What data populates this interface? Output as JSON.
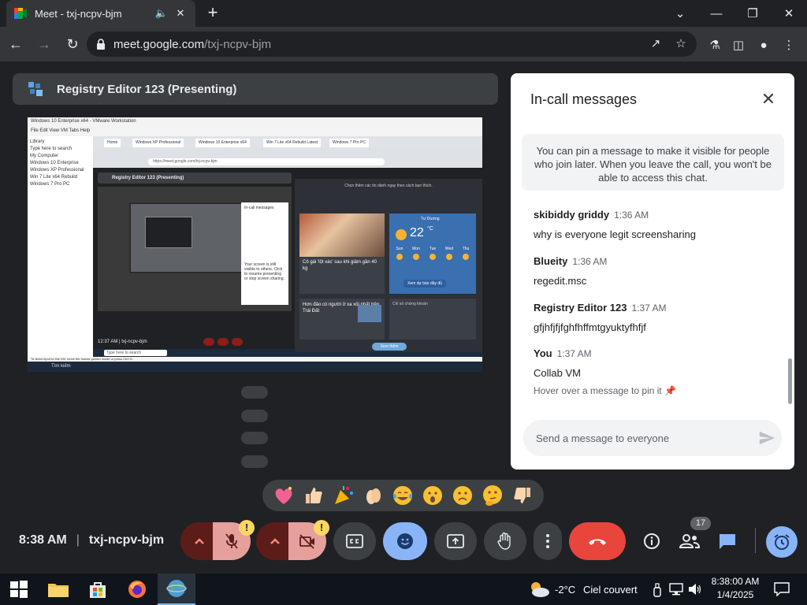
{
  "browser": {
    "tab_title": "Meet - txj-ncpv-bjm",
    "url_host": "meet.google.com",
    "url_path": "/txj-ncpv-bjm"
  },
  "stage": {
    "presenter_title": "Registry Editor 123 (Presenting)"
  },
  "shared_screen": {
    "vm_title": "Windows 10 Enterprise x64 - VMware Workstation",
    "vm_menu": "File  Edit  View  VM  Tabs  Help",
    "library_items": [
      "Library",
      "Type here to search",
      "My Computer",
      "Windows 10 Enterprise",
      "Windows XP Professional",
      "Win 7 Lite x64 Rebuild",
      "Windows 7 Pro PC"
    ],
    "vm_tabs": [
      "Home",
      "Windows XP Professional",
      "Windows 10 Enterprise x64",
      "Win 7 Lite x64 Rebuild Latest",
      "Windows 7 Pro PC"
    ],
    "inner_url": "https://meet.google.com/txj-ncpv-bjm",
    "inner_presenter": "Registry Editor 123 (Presenting)",
    "inner_chat_title": "In-call messages",
    "inner_chat_body": "Your screen is still visible to others. Click to resume presenting or stop screen sharing.",
    "inner_meeting": "12:37 AM  |  txj-ncpv-bjm",
    "inner_search": "Type here to search",
    "widget_top": "Chọn thêm các tin dành ngay theo cách bạn thích.",
    "news_caption": "Cô gái 'lột xác' sau khi giảm gần 40 kg",
    "weather_loc": "Tư Dương",
    "weather_temp": "22",
    "weather_unit": "°C",
    "weather_days": [
      "Sun",
      "Mon",
      "Tue",
      "Wed",
      "Thu"
    ],
    "weather_button": "Xem dự báo đầy đủ",
    "news2_caption": "Hơn đảo có người ở xa xôi nhất trên Trái Đất",
    "card3": "Chỉ số chứng khoán",
    "pill": "Xem thêm",
    "vm_status": "To direct input to this VM, move the mouse pointer inside or press Ctrl+G.",
    "host_taskbar": "Tìm kiếm"
  },
  "chat": {
    "title": "In-call messages",
    "pin_info": "You can pin a message to make it visible for people who join later. When you leave the call, you won't be able to access this chat.",
    "messages": [
      {
        "sender": "skibiddy griddy",
        "time": "1:36 AM",
        "text": "why is everyone legit screensharing"
      },
      {
        "sender": "Blueity",
        "time": "1:36 AM",
        "text": "regedit.msc"
      },
      {
        "sender": "Registry Editor 123",
        "time": "1:37 AM",
        "text": "gfjhfjfjfghfhffmtgyuktyfhfjf"
      },
      {
        "sender": "You",
        "time": "1:37 AM",
        "text": "Collab VM",
        "hint": "Hover over a message to pin it"
      }
    ],
    "input_placeholder": "Send a message to everyone"
  },
  "controls": {
    "time": "8:38 AM",
    "separator": "|",
    "meeting_code": "txj-ncpv-bjm",
    "warning_glyph": "!",
    "participants_count": "17"
  },
  "colors": {
    "end_call": "#e8453c",
    "active_blue": "#8ab4f8",
    "muted_red": "#f28b82"
  },
  "taskbar": {
    "weather": "-2°C",
    "weather_desc": "Ciel couvert",
    "time": "8:38:00 AM",
    "date": "1/4/2025"
  }
}
